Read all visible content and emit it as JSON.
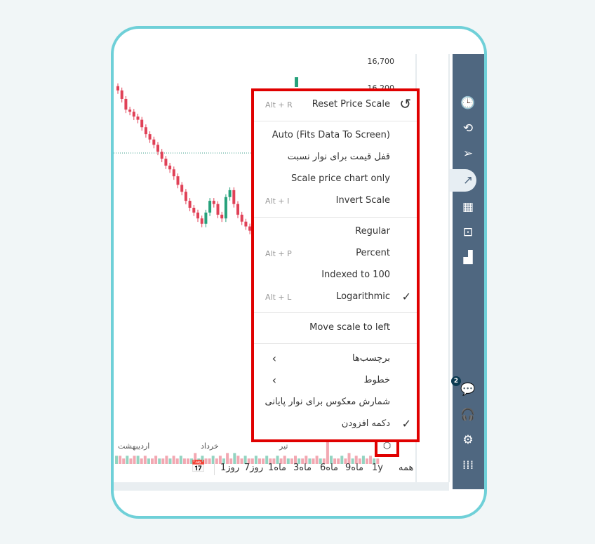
{
  "price_axis": {
    "labels": [
      "16,700",
      "16,200"
    ]
  },
  "chart_data": {
    "type": "candlestick",
    "scale": "logarithmic",
    "candles_close": [
      16650,
      16490,
      16290,
      16250,
      16160,
      16100,
      15960,
      15830,
      15730,
      15630,
      15500,
      15370,
      15240,
      15170,
      15040,
      14880,
      14750,
      14580,
      14450,
      14360,
      14250,
      14150,
      14360,
      14580,
      14520,
      14320,
      14250,
      14650,
      14780,
      14520,
      14320,
      14190,
      14100,
      14020
    ],
    "volume": [
      3,
      3,
      2,
      3,
      2,
      3,
      3,
      2,
      3,
      2,
      2,
      3,
      2,
      2,
      3,
      2,
      3,
      2,
      3,
      2,
      2,
      2,
      4,
      2,
      3,
      2,
      2,
      3,
      2,
      3,
      2,
      4,
      2,
      4,
      3,
      2,
      3,
      2,
      2,
      3,
      2,
      2,
      3,
      2,
      2,
      3,
      2,
      3,
      2,
      2,
      3,
      2,
      2,
      3,
      2,
      2,
      3,
      2,
      2,
      30,
      3,
      2,
      2,
      3,
      2,
      4,
      2,
      3,
      2,
      3,
      2,
      3,
      2,
      2
    ],
    "volume_up": [
      4,
      7,
      12,
      15,
      23,
      30,
      33,
      40,
      46,
      50,
      55,
      58,
      61,
      65,
      68,
      71
    ],
    "x_tick_labels": [
      "اردیبهشت",
      "خرداد",
      "تیر"
    ]
  },
  "menu": {
    "reset": {
      "label": "Reset Price Scale",
      "shortcut": "Alt + R",
      "icon": "reset-icon"
    },
    "items1": [
      {
        "label": "Auto (Fits Data To Screen)"
      },
      {
        "label": "قفل قیمت برای نوار نسبت"
      },
      {
        "label": "Scale price chart only"
      },
      {
        "label": "Invert Scale",
        "shortcut": "Alt + I"
      }
    ],
    "items2": [
      {
        "label": "Regular"
      },
      {
        "label": "Percent",
        "shortcut": "Alt + P"
      },
      {
        "label": "Indexed to 100"
      },
      {
        "label": "Logarithmic",
        "shortcut": "Alt + L",
        "checked": true
      }
    ],
    "move_scale": "Move scale to left",
    "items3": [
      {
        "label": "برچسب‌ها",
        "submenu": true
      },
      {
        "label": "خطوط",
        "submenu": true
      },
      {
        "label": "شمارش معکوس برای نوار پایانی"
      },
      {
        "label": "دکمه افزودن",
        "checked": true
      }
    ],
    "check_glyph": "✓",
    "chevron_glyph": "‹"
  },
  "timeframes": [
    "همه",
    "1y",
    "9ماه",
    "6ماه",
    "3ماه",
    "1ماه",
    "7روز",
    "1روز"
  ],
  "sidebar": {
    "badge": "2"
  },
  "colors": {
    "up": "#26a17b",
    "down": "#e04157",
    "vol_up": "#93d4c1",
    "vol_down": "#f2a8b2",
    "highlight": "#e00000",
    "sidebar": "#4f6780",
    "frame": "#6fd0d8"
  }
}
